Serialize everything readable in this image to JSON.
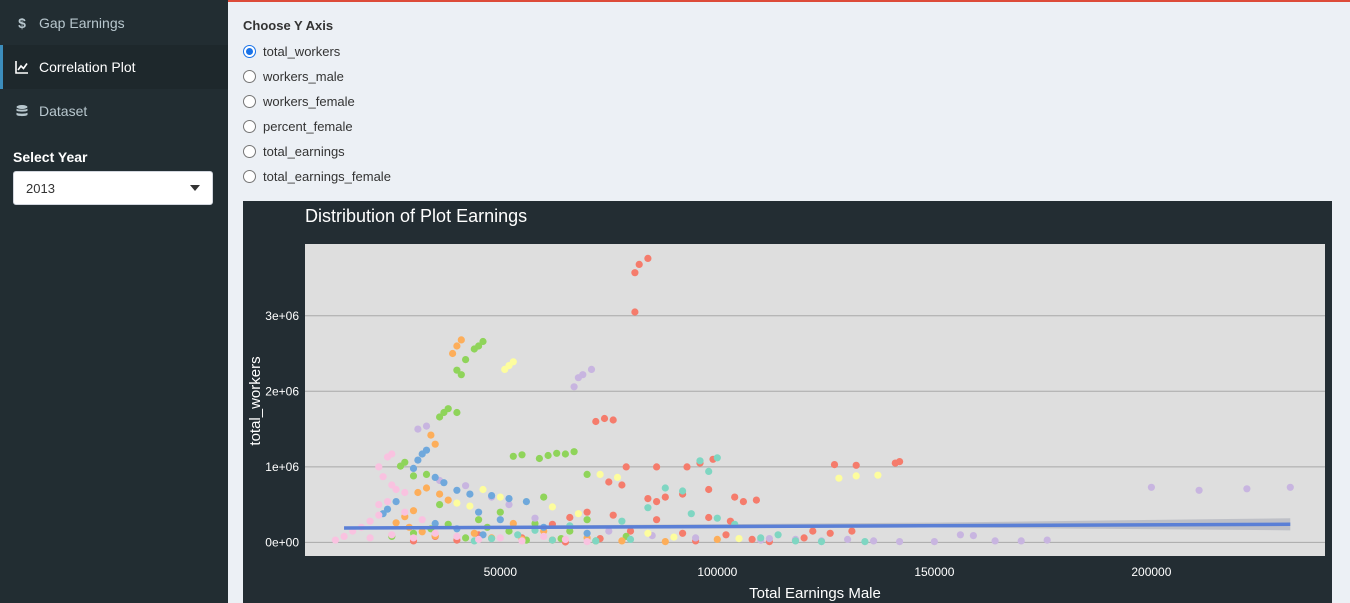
{
  "sidebar": {
    "items": [
      {
        "label": "Gap Earnings",
        "icon": "dollar-icon"
      },
      {
        "label": "Correlation Plot",
        "icon": "line-chart-icon"
      },
      {
        "label": "Dataset",
        "icon": "database-icon"
      }
    ],
    "select_label": "Select Year",
    "select_value": "2013"
  },
  "main": {
    "radio_title": "Choose Y Axis",
    "options": [
      "total_workers",
      "workers_male",
      "workers_female",
      "percent_female",
      "total_earnings",
      "total_earnings_female"
    ],
    "selected": "total_workers"
  },
  "colors": {
    "sidebar_bg": "#222d32",
    "plot_bg": "#232d33",
    "panel_bg": "#dedede",
    "accent_top": "#dd4b39",
    "fit_line": "#5a7fd6"
  },
  "chart_data": {
    "type": "scatter",
    "title": "Distribution of Plot Earnings",
    "xlabel": "Total Earnings Male",
    "ylabel": "total_workers",
    "xlim": [
      5000,
      240000
    ],
    "ylim": [
      -180000,
      3950000
    ],
    "x_ticks": [
      "50000",
      "100000",
      "150000",
      "200000"
    ],
    "x_tick_values": [
      50000,
      100000,
      150000,
      200000
    ],
    "y_ticks": [
      "0e+00",
      "1e+06",
      "2e+06",
      "3e+06"
    ],
    "y_tick_values": [
      0,
      1000000,
      2000000,
      3000000
    ],
    "grid": true,
    "trend": {
      "x": [
        14000,
        232000
      ],
      "y": [
        190000,
        240000
      ],
      "band": 80000
    },
    "series": [
      {
        "color": "#f57c6c",
        "points": [
          [
            81000,
            3050000
          ],
          [
            81000,
            3570000
          ],
          [
            82000,
            3680000
          ],
          [
            84000,
            3760000
          ],
          [
            72000,
            1600000
          ],
          [
            74000,
            1640000
          ],
          [
            76000,
            1620000
          ],
          [
            79000,
            1000000
          ],
          [
            86000,
            1000000
          ],
          [
            93000,
            1000000
          ],
          [
            96000,
            1050000
          ],
          [
            99000,
            1100000
          ],
          [
            127000,
            1030000
          ],
          [
            132000,
            1020000
          ],
          [
            141000,
            1050000
          ],
          [
            142000,
            1070000
          ],
          [
            75000,
            800000
          ],
          [
            78000,
            760000
          ],
          [
            88000,
            600000
          ],
          [
            92000,
            640000
          ],
          [
            98000,
            700000
          ],
          [
            104000,
            600000
          ],
          [
            106000,
            540000
          ],
          [
            109000,
            560000
          ],
          [
            84000,
            580000
          ],
          [
            86000,
            540000
          ],
          [
            70000,
            400000
          ],
          [
            66000,
            330000
          ],
          [
            62000,
            240000
          ],
          [
            58000,
            200000
          ],
          [
            80000,
            150000
          ],
          [
            92000,
            120000
          ],
          [
            102000,
            100000
          ],
          [
            122000,
            150000
          ],
          [
            126000,
            120000
          ],
          [
            131000,
            150000
          ],
          [
            108000,
            40000
          ],
          [
            118000,
            30000
          ],
          [
            95000,
            20000
          ],
          [
            73000,
            50000
          ],
          [
            55000,
            60000
          ],
          [
            45000,
            100000
          ],
          [
            40000,
            30000
          ],
          [
            35000,
            80000
          ],
          [
            30000,
            20000
          ],
          [
            65000,
            5000
          ],
          [
            112000,
            10000
          ],
          [
            103000,
            280000
          ],
          [
            98000,
            330000
          ],
          [
            86000,
            300000
          ],
          [
            76000,
            360000
          ],
          [
            120000,
            60000
          ]
        ]
      },
      {
        "color": "#8fd45a",
        "points": [
          [
            40000,
            2280000
          ],
          [
            41000,
            2220000
          ],
          [
            42000,
            2420000
          ],
          [
            44000,
            2560000
          ],
          [
            45000,
            2600000
          ],
          [
            46000,
            2660000
          ],
          [
            36000,
            1660000
          ],
          [
            37000,
            1720000
          ],
          [
            38000,
            1770000
          ],
          [
            40000,
            1720000
          ],
          [
            27000,
            1010000
          ],
          [
            28000,
            1060000
          ],
          [
            30000,
            880000
          ],
          [
            33000,
            900000
          ],
          [
            53000,
            1140000
          ],
          [
            55000,
            1160000
          ],
          [
            59000,
            1110000
          ],
          [
            61000,
            1150000
          ],
          [
            63000,
            1180000
          ],
          [
            65000,
            1170000
          ],
          [
            67000,
            1200000
          ],
          [
            70000,
            900000
          ],
          [
            60000,
            600000
          ],
          [
            50000,
            400000
          ],
          [
            45000,
            300000
          ],
          [
            38000,
            240000
          ],
          [
            34000,
            180000
          ],
          [
            30000,
            120000
          ],
          [
            25000,
            80000
          ],
          [
            42000,
            60000
          ],
          [
            56000,
            30000
          ],
          [
            64000,
            50000
          ],
          [
            72000,
            20000
          ],
          [
            79000,
            80000
          ],
          [
            52000,
            150000
          ],
          [
            47000,
            200000
          ],
          [
            58000,
            250000
          ],
          [
            66000,
            150000
          ],
          [
            70000,
            300000
          ],
          [
            36000,
            500000
          ]
        ]
      },
      {
        "color": "#fdae5a",
        "points": [
          [
            39000,
            2500000
          ],
          [
            40000,
            2600000
          ],
          [
            41000,
            2680000
          ],
          [
            34000,
            1420000
          ],
          [
            35000,
            1300000
          ],
          [
            31000,
            660000
          ],
          [
            33000,
            720000
          ],
          [
            36000,
            640000
          ],
          [
            38000,
            560000
          ],
          [
            30000,
            420000
          ],
          [
            28000,
            340000
          ],
          [
            26000,
            260000
          ],
          [
            29000,
            200000
          ],
          [
            32000,
            140000
          ],
          [
            35000,
            90000
          ],
          [
            44000,
            120000
          ],
          [
            48000,
            60000
          ],
          [
            55000,
            40000
          ],
          [
            62000,
            30000
          ],
          [
            70000,
            60000
          ],
          [
            78000,
            20000
          ],
          [
            88000,
            10000
          ],
          [
            100000,
            40000
          ],
          [
            60000,
            150000
          ],
          [
            53000,
            250000
          ]
        ]
      },
      {
        "color": "#c8b5e0",
        "points": [
          [
            67000,
            2060000
          ],
          [
            68000,
            2180000
          ],
          [
            69000,
            2220000
          ],
          [
            71000,
            2290000
          ],
          [
            31000,
            1500000
          ],
          [
            33000,
            1540000
          ],
          [
            200000,
            730000
          ],
          [
            211000,
            690000
          ],
          [
            222000,
            710000
          ],
          [
            232000,
            730000
          ],
          [
            150000,
            10000
          ],
          [
            156000,
            100000
          ],
          [
            159000,
            90000
          ],
          [
            164000,
            20000
          ],
          [
            170000,
            20000
          ],
          [
            176000,
            30000
          ],
          [
            142000,
            10000
          ],
          [
            136000,
            20000
          ],
          [
            130000,
            40000
          ],
          [
            124000,
            20000
          ],
          [
            118000,
            40000
          ],
          [
            112000,
            50000
          ],
          [
            58000,
            320000
          ],
          [
            48000,
            600000
          ],
          [
            42000,
            750000
          ],
          [
            36000,
            820000
          ],
          [
            52000,
            500000
          ],
          [
            75000,
            150000
          ],
          [
            85000,
            90000
          ],
          [
            95000,
            60000
          ],
          [
            110000,
            30000
          ]
        ]
      },
      {
        "color": "#fdfd9e",
        "points": [
          [
            51000,
            2290000
          ],
          [
            52000,
            2340000
          ],
          [
            53000,
            2390000
          ],
          [
            73000,
            900000
          ],
          [
            77000,
            860000
          ],
          [
            128000,
            850000
          ],
          [
            132000,
            880000
          ],
          [
            137000,
            890000
          ],
          [
            46000,
            700000
          ],
          [
            50000,
            600000
          ],
          [
            40000,
            520000
          ],
          [
            43000,
            480000
          ],
          [
            56000,
            540000
          ],
          [
            62000,
            470000
          ],
          [
            68000,
            380000
          ],
          [
            84000,
            120000
          ],
          [
            90000,
            70000
          ],
          [
            105000,
            50000
          ]
        ]
      },
      {
        "color": "#6fa8dc",
        "points": [
          [
            30000,
            980000
          ],
          [
            31000,
            1090000
          ],
          [
            32000,
            1170000
          ],
          [
            33000,
            1220000
          ],
          [
            35000,
            860000
          ],
          [
            37000,
            790000
          ],
          [
            40000,
            690000
          ],
          [
            43000,
            640000
          ],
          [
            48000,
            620000
          ],
          [
            52000,
            580000
          ],
          [
            56000,
            540000
          ],
          [
            26000,
            540000
          ],
          [
            24000,
            440000
          ],
          [
            23000,
            380000
          ],
          [
            45000,
            400000
          ],
          [
            50000,
            300000
          ],
          [
            60000,
            200000
          ],
          [
            70000,
            120000
          ],
          [
            35000,
            250000
          ],
          [
            40000,
            180000
          ],
          [
            46000,
            100000
          ]
        ]
      },
      {
        "color": "#7fd6c2",
        "points": [
          [
            96000,
            1080000
          ],
          [
            100000,
            1120000
          ],
          [
            98000,
            940000
          ],
          [
            88000,
            720000
          ],
          [
            92000,
            680000
          ],
          [
            84000,
            460000
          ],
          [
            94000,
            380000
          ],
          [
            100000,
            320000
          ],
          [
            104000,
            240000
          ],
          [
            78000,
            280000
          ],
          [
            66000,
            220000
          ],
          [
            58000,
            160000
          ],
          [
            54000,
            100000
          ],
          [
            48000,
            50000
          ],
          [
            44000,
            20000
          ],
          [
            62000,
            30000
          ],
          [
            72000,
            20000
          ],
          [
            80000,
            40000
          ],
          [
            110000,
            60000
          ],
          [
            118000,
            20000
          ],
          [
            124000,
            10000
          ],
          [
            134000,
            10000
          ],
          [
            114000,
            100000
          ]
        ]
      },
      {
        "color": "#f9c2e0",
        "points": [
          [
            24000,
            1130000
          ],
          [
            25000,
            1170000
          ],
          [
            22000,
            1000000
          ],
          [
            23000,
            870000
          ],
          [
            25000,
            760000
          ],
          [
            26000,
            700000
          ],
          [
            28000,
            660000
          ],
          [
            24000,
            540000
          ],
          [
            22000,
            360000
          ],
          [
            20000,
            280000
          ],
          [
            18000,
            200000
          ],
          [
            16000,
            150000
          ],
          [
            14000,
            80000
          ],
          [
            12000,
            30000
          ],
          [
            20000,
            60000
          ],
          [
            25000,
            100000
          ],
          [
            30000,
            60000
          ],
          [
            35000,
            120000
          ],
          [
            40000,
            80000
          ],
          [
            45000,
            40000
          ],
          [
            50000,
            60000
          ],
          [
            55000,
            20000
          ],
          [
            60000,
            80000
          ],
          [
            65000,
            40000
          ],
          [
            70000,
            10000
          ],
          [
            28000,
            400000
          ],
          [
            32000,
            300000
          ],
          [
            22000,
            500000
          ]
        ]
      }
    ]
  }
}
